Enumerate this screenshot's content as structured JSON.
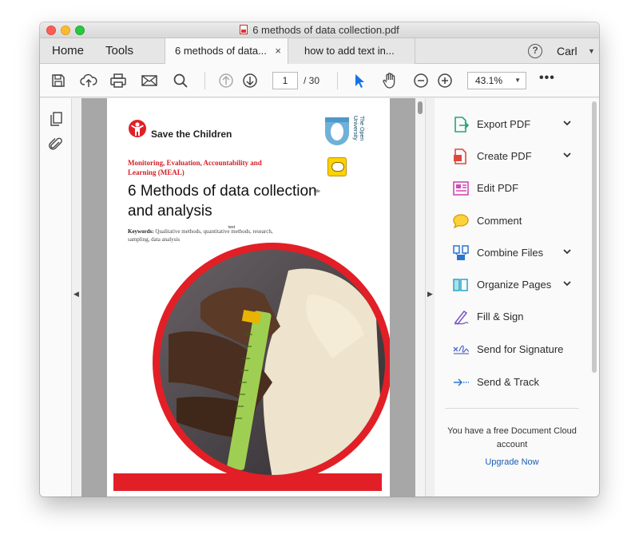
{
  "window": {
    "title": "6 methods of data collection.pdf"
  },
  "tabs": {
    "home": "Home",
    "tools": "Tools",
    "documents": [
      {
        "label": "6 methods of data...",
        "close": "×",
        "active": true
      },
      {
        "label": "how to add text in...",
        "active": false
      }
    ],
    "user": "Carl",
    "help": "?"
  },
  "toolbar": {
    "icons": [
      "save-icon",
      "upload-icon",
      "print-icon",
      "email-icon",
      "search-icon",
      "prev-page-icon",
      "next-page-icon",
      "select-cursor-icon",
      "hand-icon",
      "zoom-out-icon",
      "zoom-in-icon"
    ],
    "page_current": "1",
    "page_total": "/ 30",
    "zoom": "43.1%",
    "more": "•••"
  },
  "document": {
    "org_name": "Save the Children",
    "partner_name": "The Open University",
    "meal_heading": "Monitoring, Evaluation, Accountability and Learning (MEAL)",
    "title": "6 Methods of data collection and analysis",
    "title_mark": "title",
    "text_mark": "text",
    "keywords_label": "Keywords:",
    "keywords": "Qualitative methods, quantitative methods, research, sampling, data analysis",
    "accent_color": "#e21f26"
  },
  "tools_panel": {
    "items": [
      {
        "label": "Export PDF",
        "icon": "export-pdf-icon",
        "expandable": true,
        "color": "#27a37a"
      },
      {
        "label": "Create PDF",
        "icon": "create-pdf-icon",
        "expandable": true,
        "color": "#e0473c"
      },
      {
        "label": "Edit PDF",
        "icon": "edit-pdf-icon",
        "expandable": false,
        "color": "#d04ab3"
      },
      {
        "label": "Comment",
        "icon": "comment-icon",
        "expandable": false,
        "color": "#f1b21a"
      },
      {
        "label": "Combine Files",
        "icon": "combine-files-icon",
        "expandable": true,
        "color": "#2b76cf"
      },
      {
        "label": "Organize Pages",
        "icon": "organize-pages-icon",
        "expandable": true,
        "color": "#26a8c5"
      },
      {
        "label": "Fill & Sign",
        "icon": "fill-sign-icon",
        "expandable": false,
        "color": "#7b57c4"
      },
      {
        "label": "Send for Signature",
        "icon": "send-signature-icon",
        "expandable": false,
        "color": "#5a6fc9"
      },
      {
        "label": "Send & Track",
        "icon": "send-track-icon",
        "expandable": false,
        "color": "#2b76cf"
      }
    ],
    "cloud_message": "You have a free Document Cloud account",
    "upgrade_label": "Upgrade Now"
  }
}
